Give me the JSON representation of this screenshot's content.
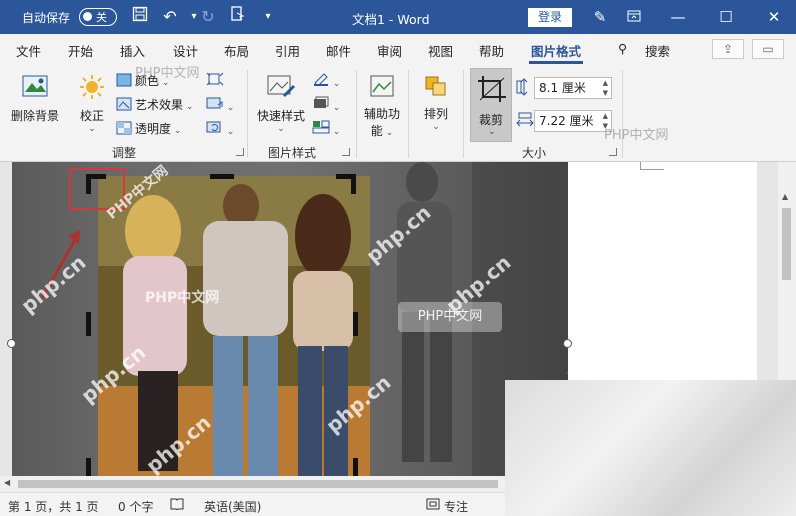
{
  "titlebar": {
    "autosave_label": "自动保存",
    "autosave_state": "关",
    "doc_title": "文档1 - Word",
    "signin_label": "登录"
  },
  "tabs": [
    {
      "label": "文件"
    },
    {
      "label": "开始"
    },
    {
      "label": "插入"
    },
    {
      "label": "设计"
    },
    {
      "label": "布局"
    },
    {
      "label": "引用"
    },
    {
      "label": "邮件"
    },
    {
      "label": "审阅"
    },
    {
      "label": "视图"
    },
    {
      "label": "帮助"
    },
    {
      "label": "图片格式",
      "active": true
    }
  ],
  "search_label": "搜索",
  "ribbon": {
    "remove_bg": "删除背景",
    "correct": "校正",
    "color": "颜色",
    "artistic": "艺术效果",
    "transparency": "透明度",
    "group_adjust": "调整",
    "quick_styles": "快速样式",
    "group_picture_styles": "图片样式",
    "accessibility_line1": "辅助功",
    "accessibility_line2": "能",
    "arrange": "排列",
    "crop": "裁剪",
    "height_value": "8.1 厘米",
    "width_value": "7.22 厘米",
    "group_size": "大小"
  },
  "watermarks": {
    "label": "PHP中文网",
    "php_cn": "php.cn"
  },
  "statusbar": {
    "page_info": "第 1 页，共 1 页",
    "word_count": "0 个字",
    "language": "英语(美国)",
    "focus": "专注"
  },
  "colors": {
    "brand": "#2b579a",
    "crop_highlight": "#d23a3a"
  }
}
